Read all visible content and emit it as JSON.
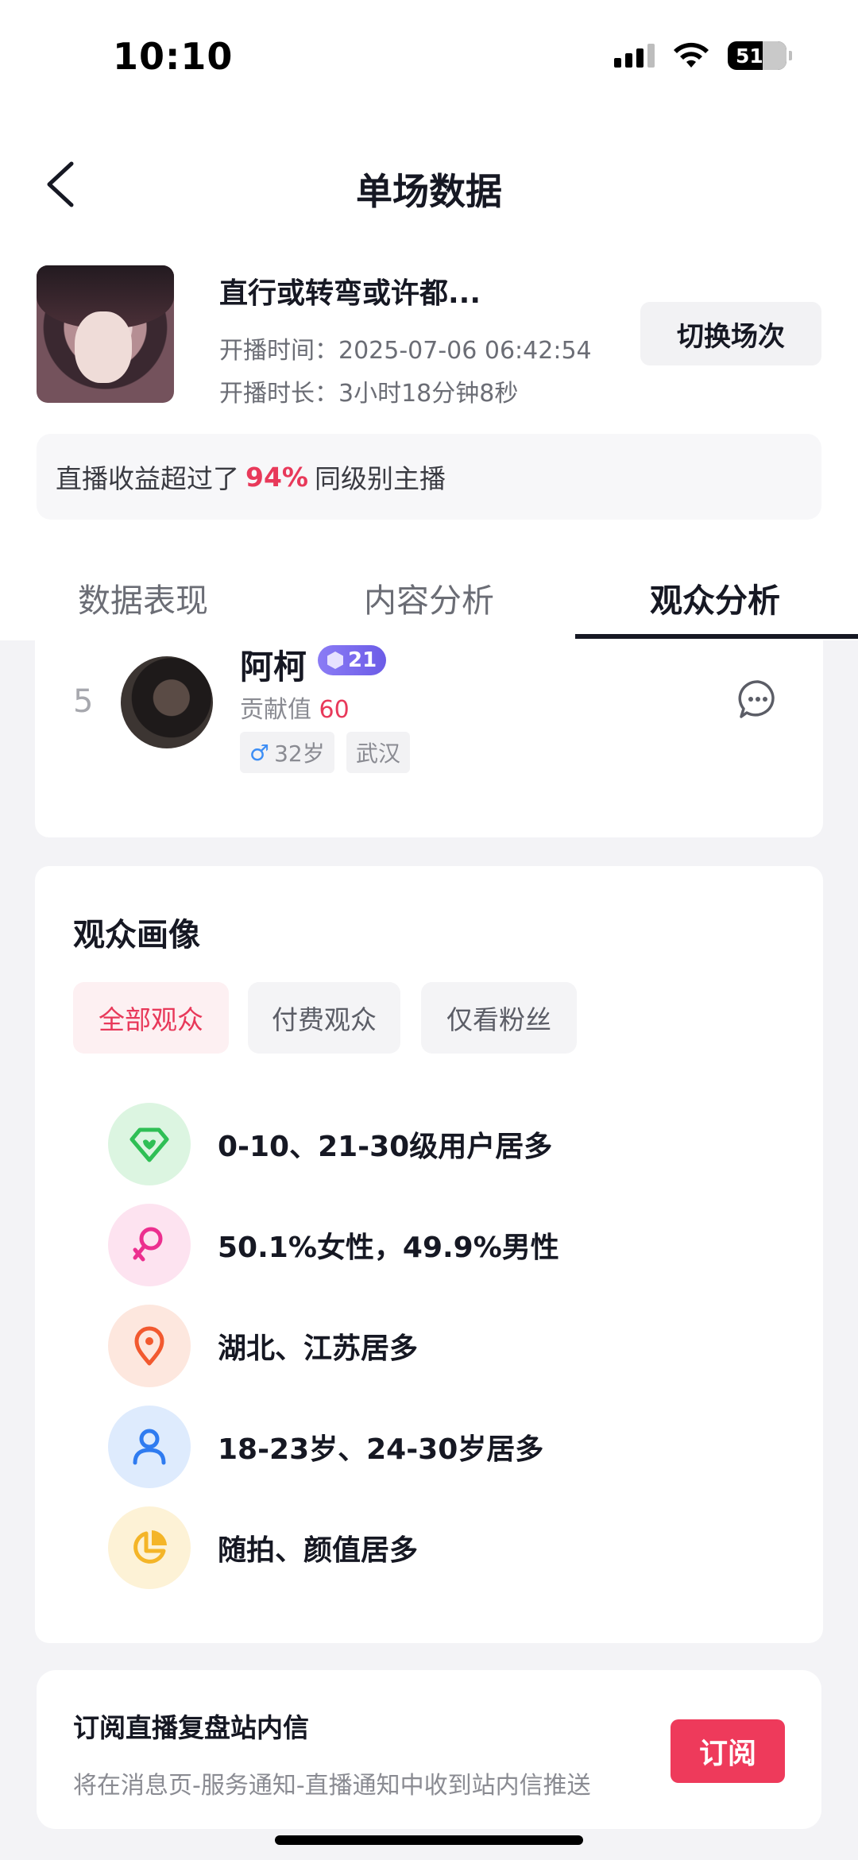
{
  "status_bar": {
    "time": "10:10",
    "battery": "51"
  },
  "header": {
    "title": "单场数据"
  },
  "room": {
    "title": "直行或转弯或许都...",
    "start_time": "开播时间：2025-07-06 06:42:54",
    "duration": "开播时长：3小时18分钟8秒",
    "switch_label": "切换场次"
  },
  "rank_banner": {
    "prefix": "直播收益超过了",
    "percent": "94%",
    "suffix": "同级别主播"
  },
  "tabs": [
    {
      "label": "数据表现"
    },
    {
      "label": "内容分析"
    },
    {
      "label": "观众分析",
      "active": true
    }
  ],
  "fan": {
    "rank": "5",
    "name": "阿柯",
    "level": "21",
    "contrib_label": "贡献值",
    "contrib_value": "60",
    "gender_symbol": "♂",
    "age": "32岁",
    "city": "武汉"
  },
  "profile": {
    "title": "观众画像",
    "filters": [
      "全部观众",
      "付费观众",
      "仅看粉丝"
    ],
    "rows": [
      {
        "icon": "diamond-heart-icon",
        "color": "#2fbf55",
        "bg": "#dcf5e1",
        "text": "0-10、21-30级用户居多"
      },
      {
        "icon": "female-icon",
        "color": "#ec2f8f",
        "bg": "#fde3f0",
        "text": "50.1%女性，49.9%男性"
      },
      {
        "icon": "location-pin-icon",
        "color": "#f2592f",
        "bg": "#fde7de",
        "text": "湖北、江苏居多"
      },
      {
        "icon": "user-icon",
        "color": "#2f7bf0",
        "bg": "#deebfd",
        "text": "18-23岁、24-30岁居多"
      },
      {
        "icon": "pie-chart-icon",
        "color": "#f4b528",
        "bg": "#fdf2d6",
        "text": "随拍、颜值居多"
      }
    ]
  },
  "subscribe": {
    "title": "订阅直播复盘站内信",
    "desc": "将在消息页-服务通知-直播通知中收到站内信推送",
    "button": "订阅"
  }
}
